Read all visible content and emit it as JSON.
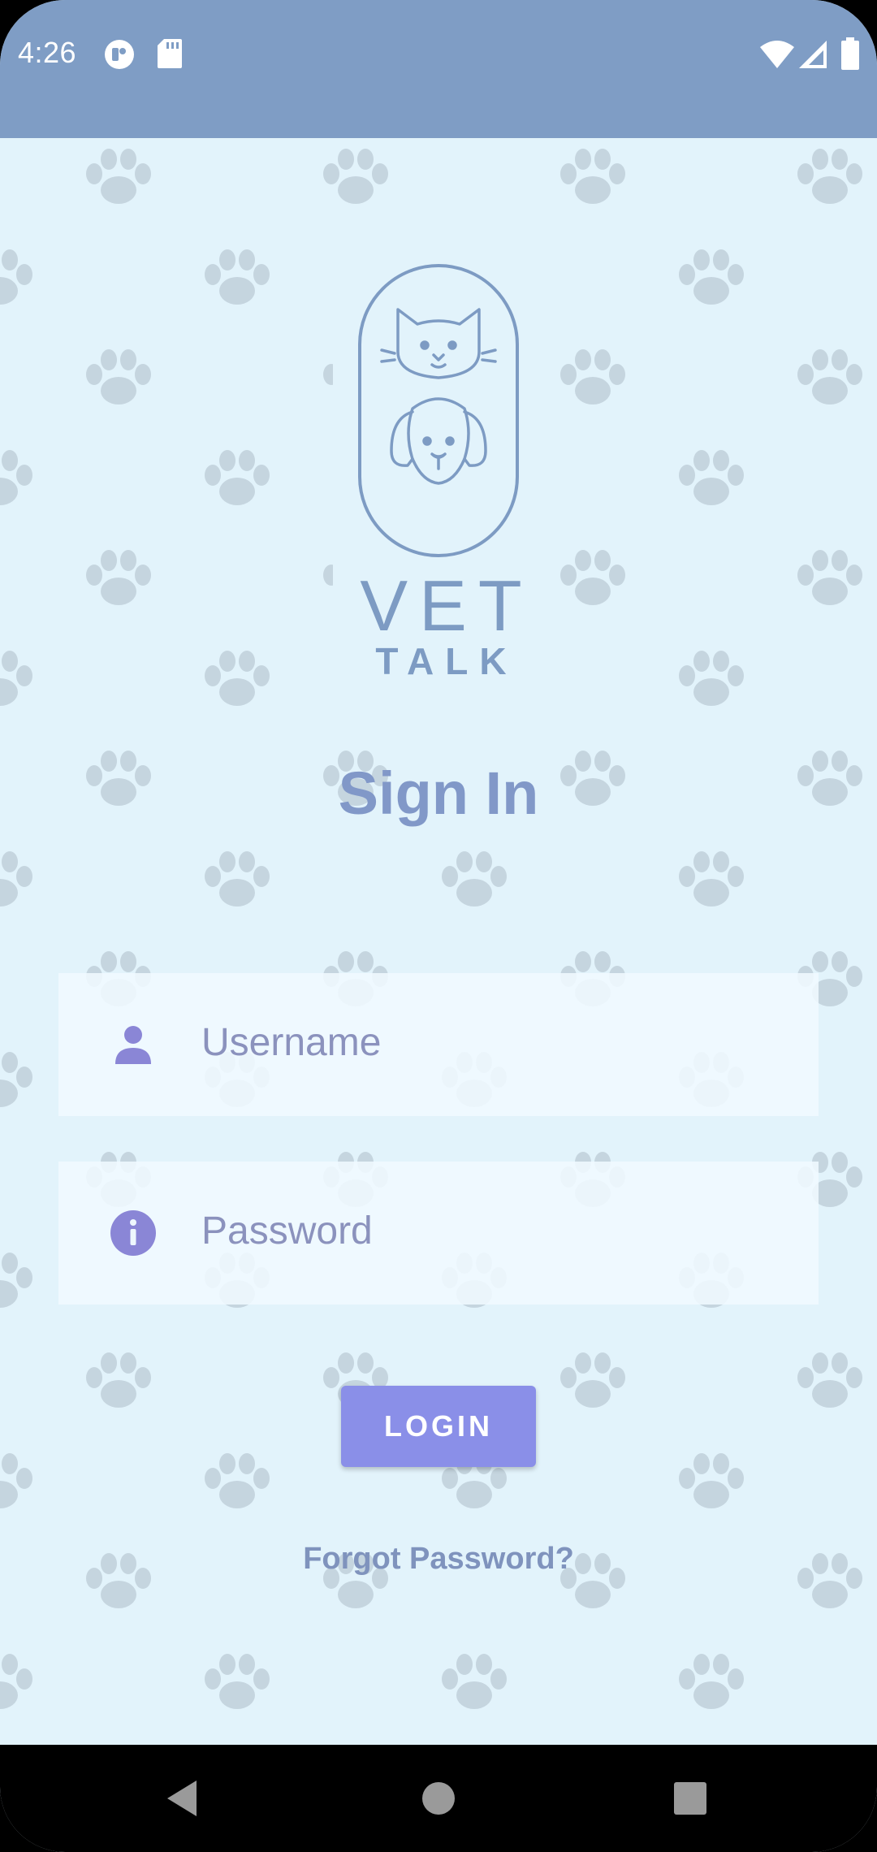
{
  "status_bar": {
    "time": "4:26",
    "icons": [
      "do-not-disturb-icon",
      "sd-card-icon",
      "wifi-icon",
      "signal-icon",
      "battery-icon"
    ]
  },
  "logo": {
    "line1": "VET",
    "line2": "TALK",
    "icons": [
      "cat-icon",
      "dog-icon"
    ]
  },
  "title": "Sign In",
  "form": {
    "username_placeholder": "Username",
    "password_placeholder": "Password",
    "username_icon": "person-icon",
    "password_icon": "info-icon"
  },
  "login_label": "LOGIN",
  "forgot_label": "Forgot Password?",
  "nav": {
    "back": "back-icon",
    "home": "home-icon",
    "recents": "recents-icon"
  },
  "colors": {
    "status_bar": "#7f9dc5",
    "background": "#e2f3fb",
    "accent": "#8a8fe8",
    "title": "#8198c8"
  }
}
